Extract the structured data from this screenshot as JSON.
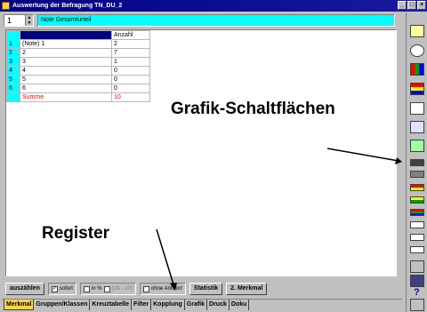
{
  "window": {
    "title": "Auswertung der Befragung TN_DU_2",
    "controls": [
      "_",
      "□",
      "×"
    ]
  },
  "question": {
    "number": "1",
    "title": "Note Gesamturteil"
  },
  "table": {
    "header": [
      "",
      "Anzahl"
    ],
    "rows": [
      {
        "num": "1",
        "label": "(Note) 1",
        "value": "2"
      },
      {
        "num": "2",
        "label": "2",
        "value": "7"
      },
      {
        "num": "3",
        "label": "3",
        "value": "1"
      },
      {
        "num": "4",
        "label": "4",
        "value": "0"
      },
      {
        "num": "5",
        "label": "5",
        "value": "0"
      },
      {
        "num": "6",
        "label": "6",
        "value": "0"
      }
    ],
    "sum": {
      "label": "Summe",
      "value": "10"
    }
  },
  "bottom": {
    "auszaehlen": "auszählen",
    "sofort": "sofort",
    "in_pct": "in %",
    "jn_label": "(JN - 10)",
    "ohne_antwort": "ohne Antwort",
    "statistik": "Statistik",
    "merkmal2": "2. Merkmal"
  },
  "tabs": [
    "Merkmal",
    "Gruppen/Klassen",
    "Kreuztabelle",
    "Filter",
    "Kopplung",
    "Grafik",
    "Druck",
    "Doku"
  ],
  "annotations": {
    "grafik": "Grafik-Schaltflächen",
    "register": "Register"
  },
  "toolbar_icons": [
    "table-icon",
    "clock-icon",
    "bar-chart-icon",
    "stacked-chart-icon",
    "line-chart-icon",
    "area-chart-icon",
    "grid-chart-icon",
    "hbar-chart-icon",
    "hbar2-chart-icon",
    "hbar3-chart-icon",
    "hbar4-chart-icon",
    "hbar5-chart-icon",
    "hbar6-chart-icon",
    "hbar7-chart-icon",
    "printer-icon",
    "save-icon",
    "help-icon",
    "exit-icon"
  ]
}
